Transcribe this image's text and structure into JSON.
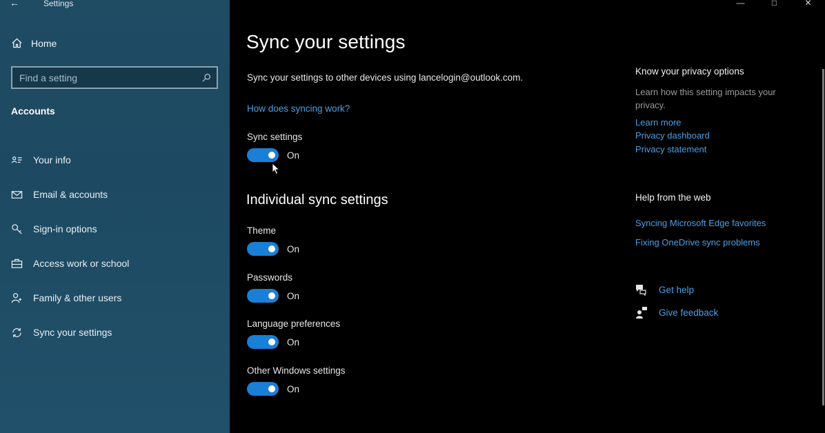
{
  "window": {
    "title": "Settings"
  },
  "sidebar": {
    "home_label": "Home",
    "search_placeholder": "Find a setting",
    "section_title": "Accounts",
    "items": [
      {
        "label": "Your info",
        "icon": "person-card-icon"
      },
      {
        "label": "Email & accounts",
        "icon": "mail-icon"
      },
      {
        "label": "Sign-in options",
        "icon": "key-icon"
      },
      {
        "label": "Access work or school",
        "icon": "briefcase-icon"
      },
      {
        "label": "Family & other users",
        "icon": "person-add-icon"
      },
      {
        "label": "Sync your settings",
        "icon": "sync-icon"
      }
    ]
  },
  "main": {
    "title": "Sync your settings",
    "description": "Sync your settings to other devices using lancelogin@outlook.com.",
    "how_link": "How does syncing work?",
    "sync_settings": {
      "label": "Sync settings",
      "state": "On"
    },
    "individual_heading": "Individual sync settings",
    "individual": [
      {
        "label": "Theme",
        "state": "On"
      },
      {
        "label": "Passwords",
        "state": "On"
      },
      {
        "label": "Language preferences",
        "state": "On"
      },
      {
        "label": "Other Windows settings",
        "state": "On"
      }
    ]
  },
  "right": {
    "privacy_heading": "Know your privacy options",
    "privacy_text": "Learn how this setting impacts your privacy.",
    "privacy_links": [
      "Learn more",
      "Privacy dashboard",
      "Privacy statement"
    ],
    "help_heading": "Help from the web",
    "help_links": [
      "Syncing Microsoft Edge favorites",
      "Fixing OneDrive sync problems"
    ],
    "get_help": "Get help",
    "give_feedback": "Give feedback"
  },
  "colors": {
    "accent": "#1a7fd6",
    "link": "#4aa0e6",
    "sidebar": "#1f4b63"
  }
}
